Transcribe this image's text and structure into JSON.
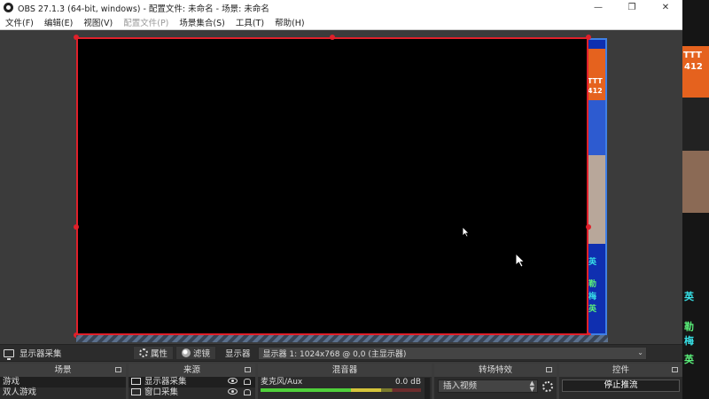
{
  "window": {
    "title": "OBS 27.1.3 (64-bit, windows) - 配置文件: 未命名 - 场景: 未命名",
    "minimize_glyph": "—",
    "maximize_glyph": "❐",
    "close_glyph": "✕"
  },
  "menu": [
    {
      "label": "文件(F)",
      "enabled": true
    },
    {
      "label": "编辑(E)",
      "enabled": true
    },
    {
      "label": "视图(V)",
      "enabled": true
    },
    {
      "label": "配置文件(P)",
      "enabled": false
    },
    {
      "label": "场景集合(S)",
      "enabled": true
    },
    {
      "label": "工具(T)",
      "enabled": true
    },
    {
      "label": "帮助(H)",
      "enabled": true
    }
  ],
  "preview_background_text": {
    "line1": "TTT",
    "line2": "412",
    "ying": "英",
    "shao": "勒",
    "mei": "梅"
  },
  "source_toolbar": {
    "source_name": "显示器采集",
    "properties_label": "属性",
    "filters_label": "滤镜",
    "display_label": "显示器",
    "display_value": "显示器 1: 1024x768 @ 0,0 (主显示器)"
  },
  "docks": {
    "scenes": {
      "title": "场景",
      "items": [
        "游戏",
        "双人游戏"
      ]
    },
    "sources": {
      "title": "来源",
      "items": [
        "显示器采集",
        "窗口采集"
      ]
    },
    "mixer": {
      "title": "混音器",
      "channel": "麦克风/Aux",
      "db": "0.0 dB",
      "level": 0.75
    },
    "transitions": {
      "title": "转场特效",
      "selected": "插入视频"
    },
    "controls": {
      "title": "控件",
      "stop_stream": "停止推流"
    }
  },
  "colors": {
    "selection_red": "#e0202a",
    "obs_panel": "#3b3b3b",
    "overlay_orange": "#e5621e"
  }
}
